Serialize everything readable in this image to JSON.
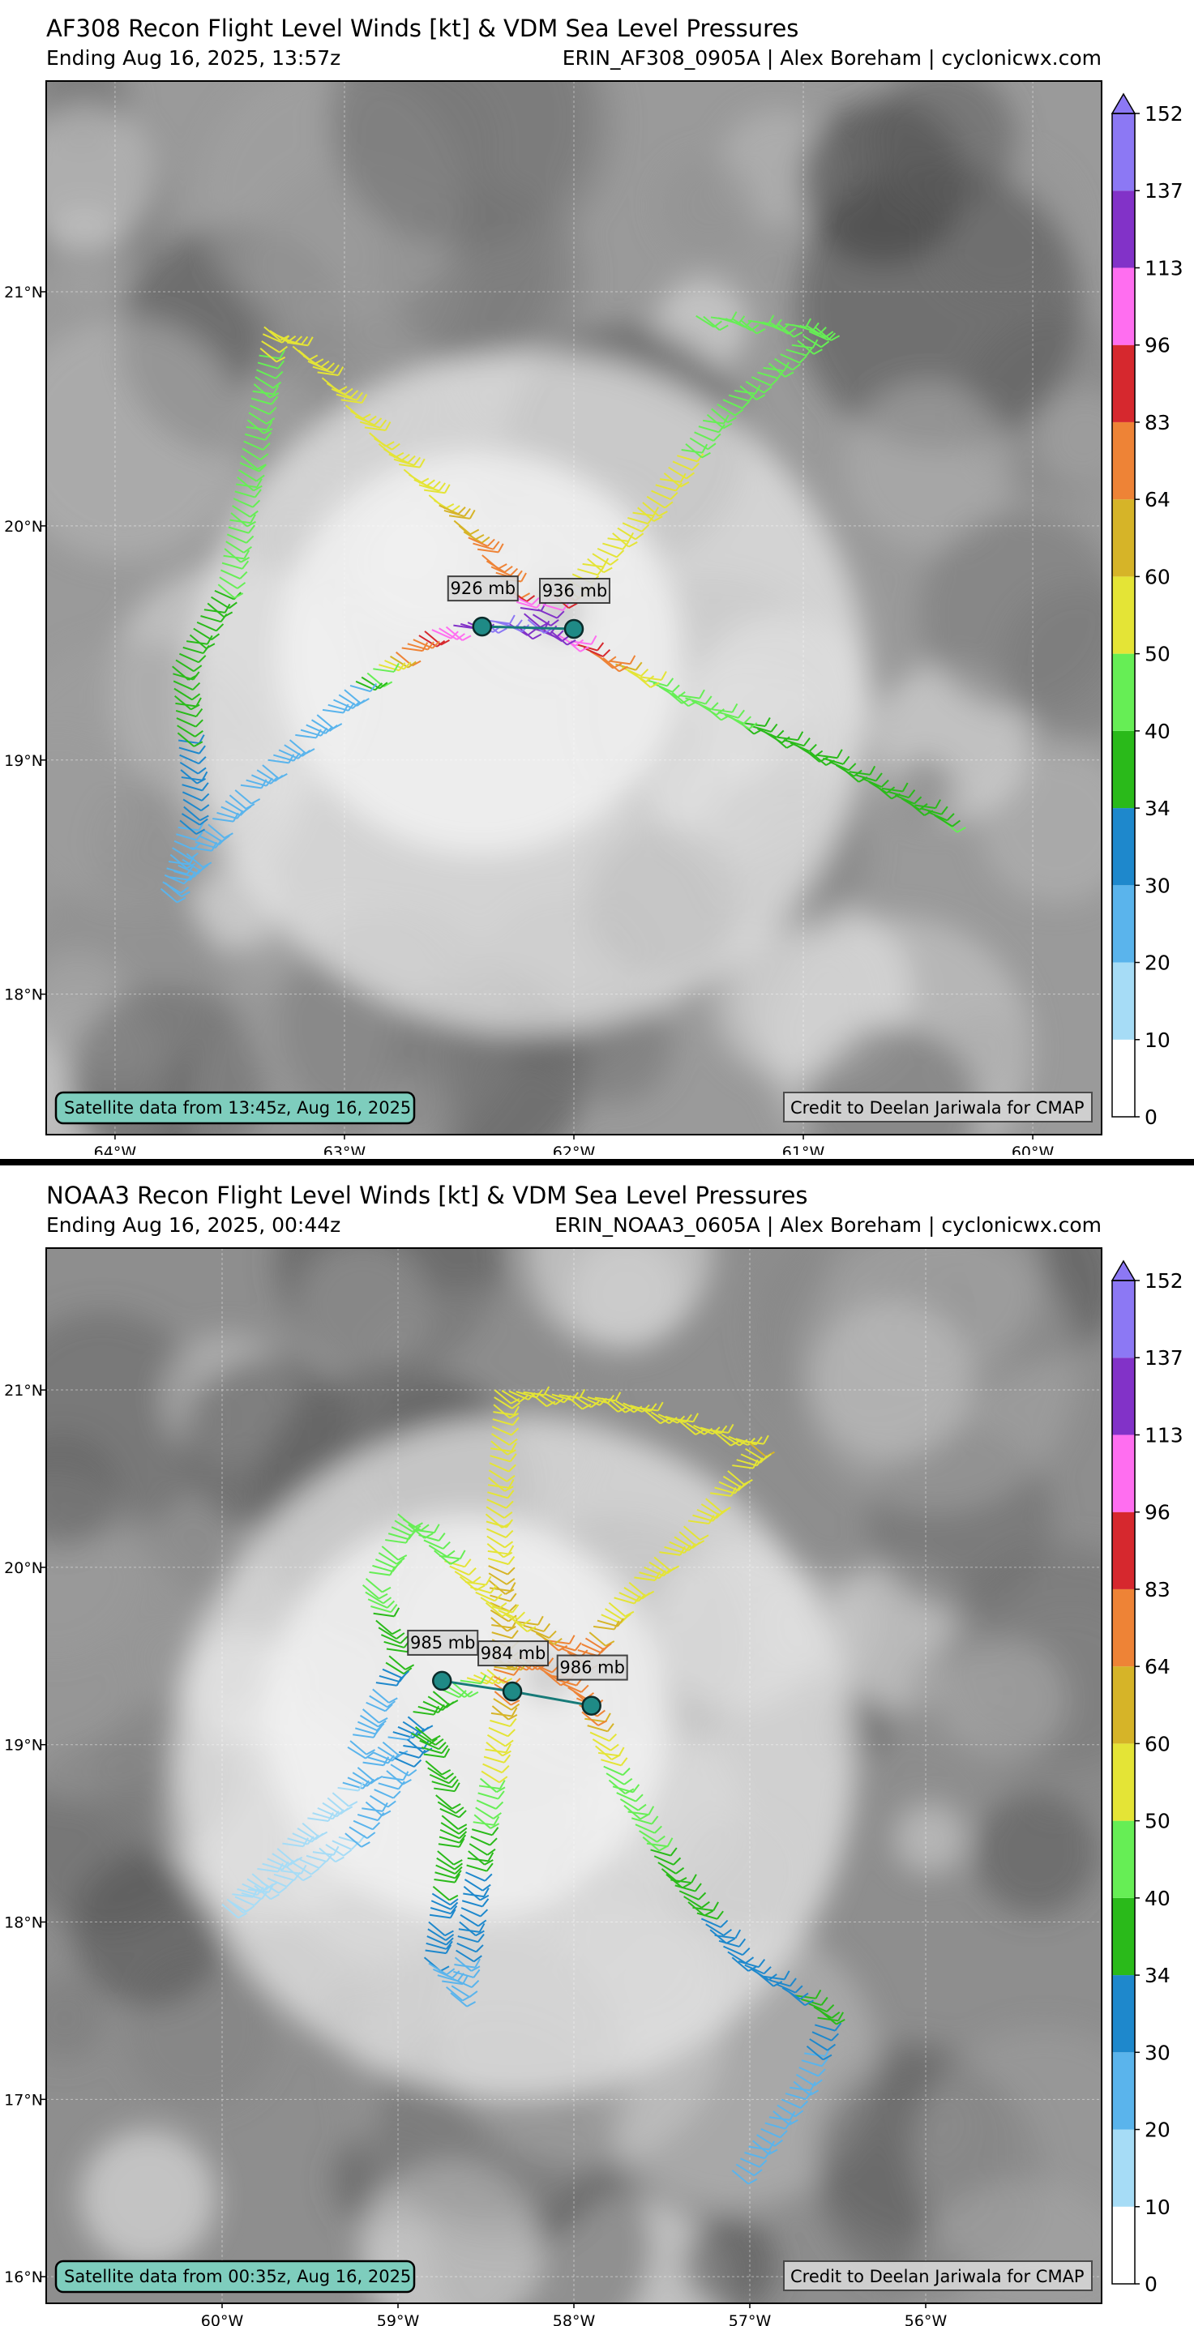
{
  "colorbar": {
    "ticks": [
      "0",
      "10",
      "20",
      "30",
      "34",
      "40",
      "50",
      "60",
      "64",
      "83",
      "96",
      "113",
      "137",
      "152"
    ],
    "colors": [
      "#ffffff",
      "#a6dcf6",
      "#5ab4ec",
      "#1e88cc",
      "#2aba1a",
      "#66ee55",
      "#e4e436",
      "#d6b428",
      "#ee8336",
      "#d6282e",
      "#ff6ef0",
      "#8232c8",
      "#8c78f4"
    ],
    "extend_color": "#8c78f4"
  },
  "panels": [
    {
      "title": "AF308 Recon Flight Level Winds [kt] & VDM Sea Level Pressures",
      "ending": "Ending Aug 16, 2025, 13:57z",
      "source": "ERIN_AF308_0905A | Alex Boreham | cyclonicwx.com",
      "satellite_note": "Satellite data from 13:45z, Aug 16, 2025",
      "credit": "Credit to Deelan Jariwala for CMAP",
      "chart_data": {
        "type": "scatter",
        "map_extent": {
          "lon": [
            -64.3,
            -59.7
          ],
          "lat": [
            17.4,
            21.9
          ]
        },
        "xticks": [
          {
            "lon": -64,
            "label": "64°W"
          },
          {
            "lon": -63,
            "label": "63°W"
          },
          {
            "lon": -62,
            "label": "62°W"
          },
          {
            "lon": -61,
            "label": "61°W"
          },
          {
            "lon": -60,
            "label": "60°W"
          }
        ],
        "yticks": [
          {
            "lat": 18,
            "label": "18°N"
          },
          {
            "lat": 19,
            "label": "19°N"
          },
          {
            "lat": 20,
            "label": "20°N"
          },
          {
            "lat": 21,
            "label": "21°N"
          }
        ],
        "flight_track": [
          {
            "lon": -60.4,
            "lat": 18.75,
            "wind": 40
          },
          {
            "lon": -61.0,
            "lat": 19.05,
            "wind": 38
          },
          {
            "lon": -61.6,
            "lat": 19.3,
            "wind": 42
          },
          {
            "lon": -61.9,
            "lat": 19.45,
            "wind": 70
          },
          {
            "lon": -62.1,
            "lat": 19.55,
            "wind": 120
          },
          {
            "lon": -62.4,
            "lat": 19.6,
            "wind": 145
          },
          {
            "lon": -62.65,
            "lat": 19.55,
            "wind": 90
          },
          {
            "lon": -63.0,
            "lat": 19.3,
            "wind": 25
          },
          {
            "lon": -63.5,
            "lat": 18.85,
            "wind": 22
          },
          {
            "lon": -63.8,
            "lat": 18.45,
            "wind": 20
          },
          {
            "lon": -63.7,
            "lat": 18.8,
            "wind": 32
          },
          {
            "lon": -63.75,
            "lat": 19.4,
            "wind": 36
          },
          {
            "lon": -63.55,
            "lat": 19.75,
            "wind": 40
          },
          {
            "lon": -63.45,
            "lat": 20.3,
            "wind": 42
          },
          {
            "lon": -63.35,
            "lat": 20.85,
            "wind": 52
          },
          {
            "lon": -63.2,
            "lat": 20.75,
            "wind": 55
          },
          {
            "lon": -62.85,
            "lat": 20.35,
            "wind": 55
          },
          {
            "lon": -62.5,
            "lat": 20.0,
            "wind": 62
          },
          {
            "lon": -62.3,
            "lat": 19.75,
            "wind": 80
          },
          {
            "lon": -62.2,
            "lat": 19.6,
            "wind": 145
          },
          {
            "lon": -62.05,
            "lat": 19.75,
            "wind": 60
          },
          {
            "lon": -61.7,
            "lat": 20.1,
            "wind": 55
          },
          {
            "lon": -61.4,
            "lat": 20.5,
            "wind": 45
          },
          {
            "lon": -60.95,
            "lat": 20.85,
            "wind": 48
          },
          {
            "lon": -61.5,
            "lat": 20.9,
            "wind": 45
          }
        ],
        "vdm": [
          {
            "lon": -62.4,
            "lat": 19.57,
            "label": "926 mb"
          },
          {
            "lon": -62.0,
            "lat": 19.56,
            "label": "936 mb"
          }
        ]
      }
    },
    {
      "title": "NOAA3 Recon Flight Level Winds [kt] & VDM Sea Level Pressures",
      "ending": "Ending Aug 16, 2025, 00:44z",
      "source": "ERIN_NOAA3_0605A | Alex Boreham | cyclonicwx.com",
      "satellite_note": "Satellite data from 00:35z, Aug 16, 2025",
      "credit": "Credit to Deelan Jariwala for CMAP",
      "chart_data": {
        "type": "scatter",
        "map_extent": {
          "lon": [
            -61.0,
            -55.0
          ],
          "lat": [
            15.85,
            21.8
          ]
        },
        "xticks": [
          {
            "lon": -60,
            "label": "60°W"
          },
          {
            "lon": -59,
            "label": "59°W"
          },
          {
            "lon": -58,
            "label": "58°W"
          },
          {
            "lon": -57,
            "label": "57°W"
          },
          {
            "lon": -56,
            "label": "56°W"
          }
        ],
        "yticks": [
          {
            "lat": 16,
            "label": "16°N"
          },
          {
            "lat": 17,
            "label": "17°N"
          },
          {
            "lat": 18,
            "label": "18°N"
          },
          {
            "lat": 19,
            "label": "19°N"
          },
          {
            "lat": 20,
            "label": "20°N"
          },
          {
            "lat": 21,
            "label": "21°N"
          }
        ],
        "flight_track": [
          {
            "lon": -57.1,
            "lat": 16.6,
            "wind": 22
          },
          {
            "lon": -56.75,
            "lat": 17.1,
            "wind": 25
          },
          {
            "lon": -56.6,
            "lat": 17.5,
            "wind": 36
          },
          {
            "lon": -57.1,
            "lat": 17.8,
            "wind": 30
          },
          {
            "lon": -57.5,
            "lat": 18.3,
            "wind": 38
          },
          {
            "lon": -57.8,
            "lat": 18.8,
            "wind": 45
          },
          {
            "lon": -58.0,
            "lat": 19.3,
            "wind": 70
          },
          {
            "lon": -58.3,
            "lat": 19.5,
            "wind": 70
          },
          {
            "lon": -58.8,
            "lat": 19.3,
            "wind": 38
          },
          {
            "lon": -59.4,
            "lat": 18.7,
            "wind": 18
          },
          {
            "lon": -60.0,
            "lat": 18.1,
            "wind": 15
          },
          {
            "lon": -59.3,
            "lat": 18.5,
            "wind": 20
          },
          {
            "lon": -58.9,
            "lat": 19.1,
            "wind": 35
          },
          {
            "lon": -58.75,
            "lat": 18.6,
            "wind": 38
          },
          {
            "lon": -58.85,
            "lat": 17.8,
            "wind": 30
          },
          {
            "lon": -58.7,
            "lat": 17.6,
            "wind": 28
          },
          {
            "lon": -58.6,
            "lat": 18.4,
            "wind": 35
          },
          {
            "lon": -58.45,
            "lat": 19.3,
            "wind": 65
          },
          {
            "lon": -58.5,
            "lat": 20.3,
            "wind": 58
          },
          {
            "lon": -58.45,
            "lat": 21.0,
            "wind": 52
          },
          {
            "lon": -57.8,
            "lat": 20.95,
            "wind": 55
          },
          {
            "lon": -57.0,
            "lat": 20.7,
            "wind": 60
          },
          {
            "lon": -57.4,
            "lat": 20.2,
            "wind": 58
          },
          {
            "lon": -57.8,
            "lat": 19.8,
            "wind": 55
          },
          {
            "lon": -58.0,
            "lat": 19.5,
            "wind": 70
          },
          {
            "lon": -58.5,
            "lat": 19.8,
            "wind": 55
          },
          {
            "lon": -59.0,
            "lat": 20.3,
            "wind": 45
          },
          {
            "lon": -59.2,
            "lat": 19.9,
            "wind": 42
          },
          {
            "lon": -59.05,
            "lat": 19.5,
            "wind": 36
          },
          {
            "lon": -59.2,
            "lat": 19.2,
            "wind": 25
          },
          {
            "lon": -59.3,
            "lat": 18.95,
            "wind": 22
          }
        ],
        "vdm": [
          {
            "lon": -58.75,
            "lat": 19.36,
            "label": "985 mb"
          },
          {
            "lon": -58.35,
            "lat": 19.3,
            "label": "984 mb"
          },
          {
            "lon": -57.9,
            "lat": 19.22,
            "label": "986 mb"
          }
        ]
      }
    }
  ]
}
